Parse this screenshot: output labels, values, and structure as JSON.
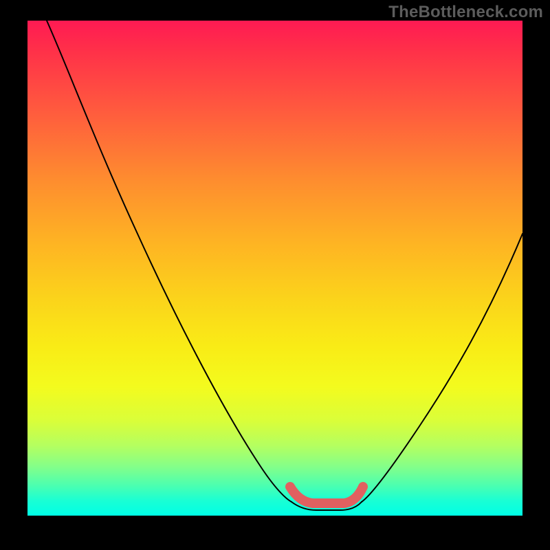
{
  "watermark": "TheBottleneck.com",
  "chart_data": {
    "type": "line",
    "title": "",
    "xlabel": "",
    "ylabel": "",
    "xlim": [
      0,
      100
    ],
    "ylim": [
      0,
      100
    ],
    "grid": false,
    "legend": false,
    "background_gradient": {
      "orientation": "vertical",
      "stops": [
        {
          "pos": 0,
          "color": "#ff1a53"
        },
        {
          "pos": 50,
          "color": "#fecb1e"
        },
        {
          "pos": 80,
          "color": "#d9fe3a"
        },
        {
          "pos": 100,
          "color": "#00ffe6"
        }
      ]
    },
    "series": [
      {
        "name": "left-descent",
        "style": "thin-black",
        "x": [
          4,
          10,
          20,
          30,
          40,
          48,
          53
        ],
        "y": [
          100,
          90,
          72,
          53,
          33,
          15,
          6
        ]
      },
      {
        "name": "right-ascent",
        "style": "thin-black",
        "x": [
          67,
          72,
          80,
          88,
          95,
          100
        ],
        "y": [
          6,
          12,
          24,
          37,
          48,
          57
        ]
      },
      {
        "name": "valley-highlight",
        "style": "thick-red",
        "x": [
          53,
          56,
          60,
          64,
          67
        ],
        "y": [
          6,
          3,
          3,
          3,
          6
        ]
      }
    ],
    "colors": {
      "thin-black": "#000000",
      "thick-red": "#e16060"
    }
  }
}
